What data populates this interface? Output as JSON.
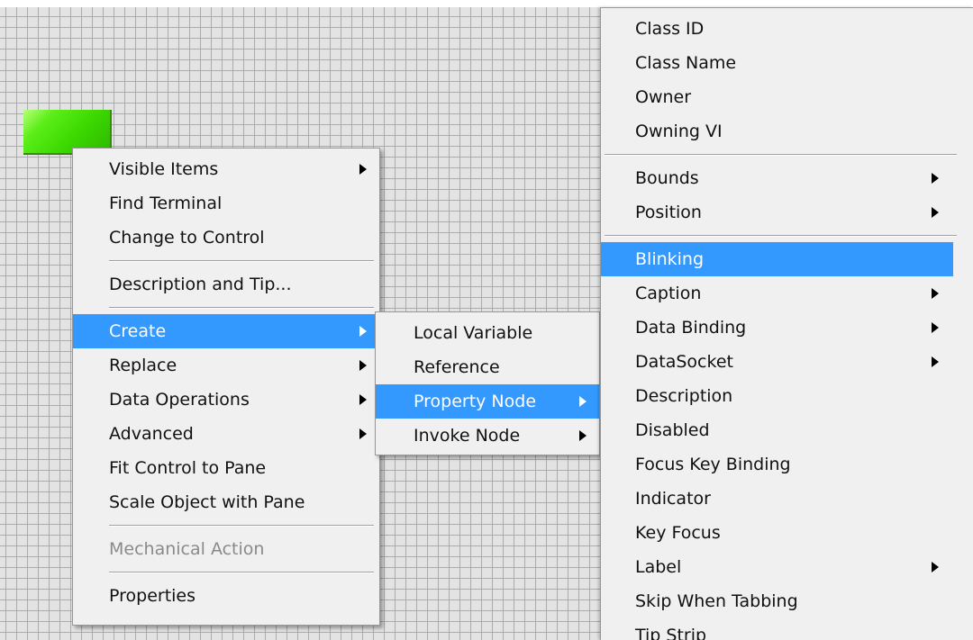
{
  "main_menu": {
    "items": [
      {
        "label": "Visible Items",
        "submenu": true
      },
      {
        "label": "Find Terminal"
      },
      {
        "label": "Change to Control"
      },
      {
        "label": "Description and Tip..."
      },
      {
        "label": "Create",
        "submenu": true,
        "highlighted": true
      },
      {
        "label": "Replace",
        "submenu": true
      },
      {
        "label": "Data Operations",
        "submenu": true
      },
      {
        "label": "Advanced",
        "submenu": true
      },
      {
        "label": "Fit Control to Pane"
      },
      {
        "label": "Scale Object with Pane"
      },
      {
        "label": "Mechanical Action",
        "disabled": true
      },
      {
        "label": "Properties"
      }
    ]
  },
  "create_menu": {
    "items": [
      {
        "label": "Local Variable"
      },
      {
        "label": "Reference"
      },
      {
        "label": "Property Node",
        "submenu": true,
        "highlighted": true
      },
      {
        "label": "Invoke Node",
        "submenu": true
      }
    ]
  },
  "property_menu": {
    "items": [
      {
        "label": "Class ID"
      },
      {
        "label": "Class Name"
      },
      {
        "label": "Owner"
      },
      {
        "label": "Owning VI"
      },
      {
        "label": "Bounds",
        "submenu": true
      },
      {
        "label": "Position",
        "submenu": true
      },
      {
        "label": "Blinking",
        "highlighted": true
      },
      {
        "label": "Caption",
        "submenu": true
      },
      {
        "label": "Data Binding",
        "submenu": true
      },
      {
        "label": "DataSocket",
        "submenu": true
      },
      {
        "label": "Description"
      },
      {
        "label": "Disabled"
      },
      {
        "label": "Focus Key Binding"
      },
      {
        "label": "Indicator"
      },
      {
        "label": "Key Focus"
      },
      {
        "label": "Label",
        "submenu": true
      },
      {
        "label": "Skip When Tabbing"
      },
      {
        "label": "Tip Strip"
      }
    ]
  },
  "colors": {
    "highlight": "#3399ff",
    "menu_bg": "#f0f0f0",
    "grid_bg": "#e3e3e3",
    "led_green": "#3cd800"
  }
}
